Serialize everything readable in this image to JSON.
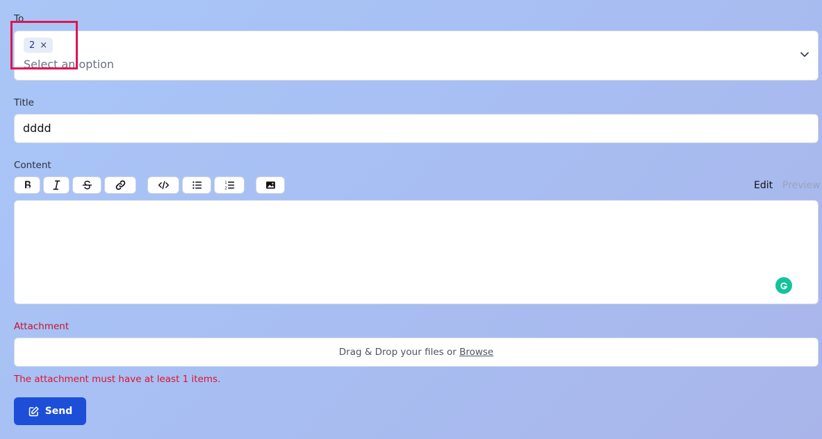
{
  "to": {
    "label": "To",
    "chip_value": "2",
    "chip_remove": "×",
    "placeholder": "Select an option"
  },
  "title": {
    "label": "Title",
    "value": "dddd"
  },
  "content": {
    "label": "Content",
    "toolbar": [
      "bold-icon",
      "italic-icon",
      "strikethrough-icon",
      "link-icon",
      "code-icon",
      "bullet-list-icon",
      "numbered-list-icon",
      "image-icon"
    ],
    "mode_edit": "Edit",
    "mode_preview": "Preview"
  },
  "attachment": {
    "label": "Attachment",
    "drop_text": "Drag & Drop your files or ",
    "browse": "Browse",
    "error": "The attachment must have at least 1 items."
  },
  "send": {
    "label": "Send"
  },
  "colors": {
    "accent": "#1d4ed8",
    "error": "#e0112b",
    "highlight": "#e01452",
    "grammarly": "#15c39a"
  }
}
